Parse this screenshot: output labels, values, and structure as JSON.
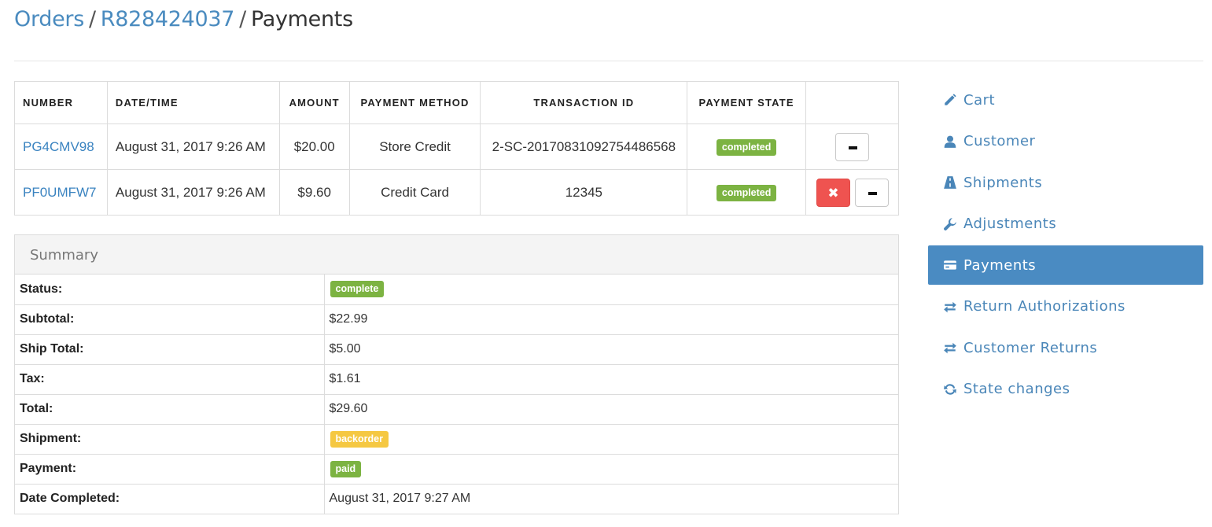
{
  "breadcrumb": {
    "root": "Orders",
    "order": "R828424037",
    "current": "Payments",
    "separator": "/"
  },
  "payments": {
    "headers": [
      "Number",
      "Date/Time",
      "Amount",
      "Payment Method",
      "Transaction ID",
      "Payment State"
    ],
    "rows": [
      {
        "number": "PG4CMV98",
        "datetime": "August 31, 2017 9:26 AM",
        "amount": "$20.00",
        "method": "Store Credit",
        "transaction_id": "2-SC-20170831092754486568",
        "state": "completed"
      },
      {
        "number": "PF0UMFW7",
        "datetime": "August 31, 2017 9:26 AM",
        "amount": "$9.60",
        "method": "Credit Card",
        "transaction_id": "12345",
        "state": "completed"
      }
    ]
  },
  "summary": {
    "title": "Summary",
    "status_label": "Status:",
    "status": "complete",
    "subtotal_label": "Subtotal:",
    "subtotal": "$22.99",
    "ship_total_label": "Ship Total:",
    "ship_total": "$5.00",
    "tax_label": "Tax:",
    "tax": "$1.61",
    "total_label": "Total:",
    "total": "$29.60",
    "shipment_label": "Shipment:",
    "shipment": "backorder",
    "payment_label": "Payment:",
    "payment": "paid",
    "date_completed_label": "Date Completed:",
    "date_completed": "August 31, 2017 9:27 AM"
  },
  "sidenav": {
    "items": [
      {
        "label": "Cart",
        "icon": "pencil-icon"
      },
      {
        "label": "Customer",
        "icon": "user-icon"
      },
      {
        "label": "Shipments",
        "icon": "road-icon"
      },
      {
        "label": "Adjustments",
        "icon": "wrench-icon"
      },
      {
        "label": "Payments",
        "icon": "credit-card-icon",
        "active": true
      },
      {
        "label": "Return Authorizations",
        "icon": "transfer-icon"
      },
      {
        "label": "Customer Returns",
        "icon": "transfer-icon"
      },
      {
        "label": "State changes",
        "icon": "refresh-icon"
      }
    ]
  },
  "colors": {
    "link": "#3a83c0",
    "active_nav": "#4a8bc2",
    "label_green": "#7cb342",
    "label_yellow": "#f5c842",
    "void_button": "#ef5350"
  }
}
